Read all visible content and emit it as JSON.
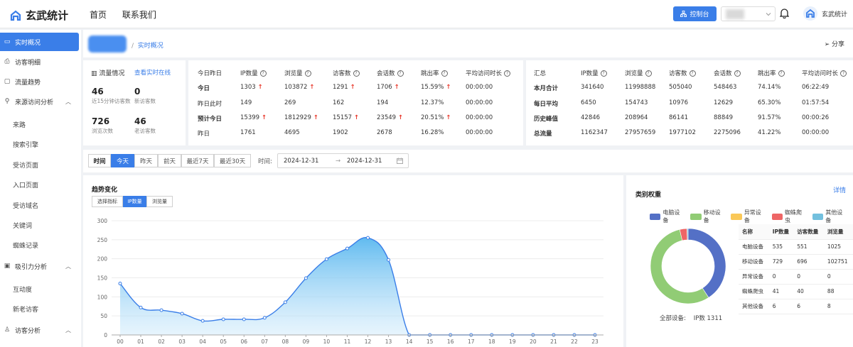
{
  "app": {
    "name": "玄武统计",
    "nav": [
      "首页",
      "联系我们"
    ],
    "control_label": "控制台",
    "user_name": "玄武统计"
  },
  "sidebar": {
    "items": [
      {
        "label": "实时概况",
        "icon": "monitor-icon",
        "active": true
      },
      {
        "label": "访客明细",
        "icon": "printer-icon"
      },
      {
        "label": "流量趋势",
        "icon": "chat-icon"
      }
    ],
    "groups": [
      {
        "label": "来源访问分析",
        "icon": "share-icon",
        "children": [
          "来路",
          "搜索引擎",
          "受访页面",
          "入口页面",
          "受访域名",
          "关键词",
          "蜘蛛记录"
        ]
      },
      {
        "label": "吸引力分析",
        "icon": "grid-icon",
        "children": [
          "互动度",
          "新老访客"
        ]
      },
      {
        "label": "访客分析",
        "icon": "users-icon",
        "children": []
      }
    ]
  },
  "breadcrumb": {
    "separator": "/",
    "current": "实时概况",
    "share_label": "分享"
  },
  "flow": {
    "title": "流量情况",
    "link": "查看实时在线",
    "stats": [
      {
        "value": "46",
        "label": "近15分钟访客数"
      },
      {
        "value": "0",
        "label": "新访客数"
      },
      {
        "value": "726",
        "label": "浏览次数"
      },
      {
        "value": "46",
        "label": "老访客数"
      }
    ]
  },
  "daily": {
    "headers": [
      "今日昨日",
      "IP数量",
      "浏览量",
      "访客数",
      "会话数",
      "跳出率",
      "平均访问时长"
    ],
    "rows": [
      {
        "label": "今日",
        "bold": true,
        "cells": [
          {
            "v": "1303",
            "up": true
          },
          {
            "v": "103872",
            "up": true
          },
          {
            "v": "1291",
            "up": true
          },
          {
            "v": "1706",
            "up": true
          },
          {
            "v": "15.59%",
            "up": true
          },
          {
            "v": "00:00:00"
          }
        ]
      },
      {
        "label": "昨日此时",
        "bold": false,
        "cells": [
          {
            "v": "149"
          },
          {
            "v": "269"
          },
          {
            "v": "162"
          },
          {
            "v": "194"
          },
          {
            "v": "12.37%"
          },
          {
            "v": "00:00:00"
          }
        ]
      },
      {
        "label": "预计今日",
        "bold": true,
        "cells": [
          {
            "v": "15399",
            "up": true
          },
          {
            "v": "1812929",
            "up": true
          },
          {
            "v": "15157",
            "up": true
          },
          {
            "v": "23549",
            "up": true
          },
          {
            "v": "20.51%",
            "up": true
          },
          {
            "v": "00:00:00"
          }
        ]
      },
      {
        "label": "昨日",
        "bold": false,
        "cells": [
          {
            "v": "1761"
          },
          {
            "v": "4695"
          },
          {
            "v": "1902"
          },
          {
            "v": "2678"
          },
          {
            "v": "16.28%"
          },
          {
            "v": "00:00:00"
          }
        ]
      }
    ]
  },
  "summary": {
    "headers": [
      "汇总",
      "IP数量",
      "浏览量",
      "访客数",
      "会话数",
      "跳出率",
      "平均访问时长"
    ],
    "rows": [
      {
        "label": "本月合计",
        "cells": [
          "341640",
          "11998888",
          "505040",
          "548463",
          "74.14%",
          "06:22:49"
        ]
      },
      {
        "label": "每日平均",
        "cells": [
          "6450",
          "154743",
          "10976",
          "12629",
          "65.30%",
          "01:57:54"
        ]
      },
      {
        "label": "历史峰值",
        "cells": [
          "42846",
          "208964",
          "86141",
          "88849",
          "91.57%",
          "00:00:26"
        ]
      },
      {
        "label": "总流量",
        "cells": [
          "1162347",
          "27957659",
          "1977102",
          "2275096",
          "41.22%",
          "00:00:00"
        ]
      }
    ]
  },
  "filter": {
    "buttons": [
      "时间",
      "今天",
      "昨天",
      "前天",
      "最近7天",
      "最近30天"
    ],
    "active_index": 1,
    "time_label": "时间:",
    "start": "2024-12-31",
    "end": "2024-12-31",
    "arrow": "→"
  },
  "trend": {
    "title": "趋势变化",
    "tabs": [
      "选择指标",
      "IP数量",
      "浏览量"
    ],
    "active_tab": 1
  },
  "chart_data": {
    "type": "area",
    "x": [
      "00",
      "01",
      "02",
      "03",
      "04",
      "05",
      "06",
      "07",
      "08",
      "09",
      "10",
      "11",
      "12",
      "13",
      "14",
      "15",
      "16",
      "17",
      "18",
      "19",
      "20",
      "21",
      "22",
      "23"
    ],
    "values": [
      135,
      72,
      65,
      56,
      37,
      41,
      41,
      45,
      86,
      149,
      199,
      227,
      255,
      197,
      0,
      0,
      0,
      0,
      0,
      0,
      0,
      0,
      0,
      0
    ],
    "yticks": [
      0,
      50,
      100,
      150,
      200,
      250,
      300
    ],
    "ylim": [
      0,
      300
    ],
    "color": "#3a7ee8",
    "grid": true
  },
  "category": {
    "title": "类别权重",
    "detail_label": "详情",
    "legend": [
      {
        "name": "电脑设备",
        "color": "#5470c6"
      },
      {
        "name": "移动设备",
        "color": "#91cc75"
      },
      {
        "name": "异常设备",
        "color": "#fac858"
      },
      {
        "name": "蜘蛛爬虫",
        "color": "#ee6666"
      },
      {
        "name": "其他设备",
        "color": "#73c0de"
      }
    ],
    "table_headers": [
      "名称",
      "IP数量",
      "访客数量",
      "浏览量"
    ],
    "rows": [
      [
        "电脑设备",
        "535",
        "551",
        "1025"
      ],
      [
        "移动设备",
        "729",
        "696",
        "102751"
      ],
      [
        "异常设备",
        "0",
        "0",
        "0"
      ],
      [
        "蜘蛛爬虫",
        "41",
        "40",
        "88"
      ],
      [
        "其他设备",
        "6",
        "6",
        "8"
      ]
    ],
    "total_label": "全部设备:",
    "total_value": "IP数 1311",
    "donut_values": [
      535,
      729,
      0,
      41,
      6
    ]
  }
}
